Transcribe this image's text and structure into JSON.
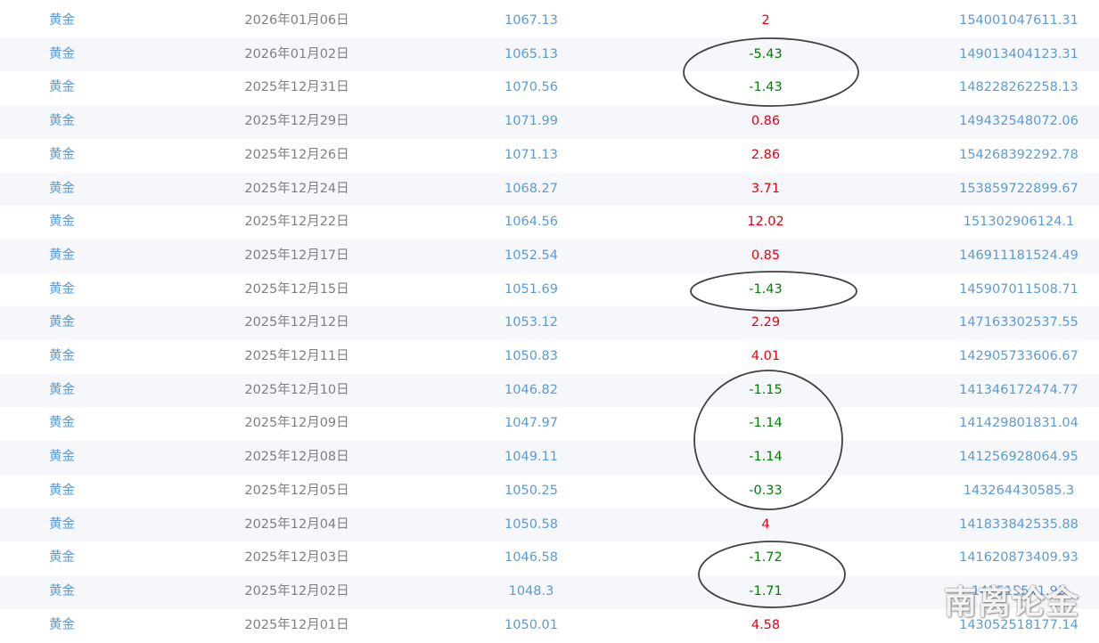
{
  "table": {
    "rows": [
      {
        "name": "黄金",
        "date": "2026年01月06日",
        "price": "1067.13",
        "change": "2",
        "direction": "up",
        "amount": "154001047611.31"
      },
      {
        "name": "黄金",
        "date": "2026年01月02日",
        "price": "1065.13",
        "change": "-5.43",
        "direction": "down",
        "amount": "149013404123.31"
      },
      {
        "name": "黄金",
        "date": "2025年12月31日",
        "price": "1070.56",
        "change": "-1.43",
        "direction": "down",
        "amount": "148228262258.13"
      },
      {
        "name": "黄金",
        "date": "2025年12月29日",
        "price": "1071.99",
        "change": "0.86",
        "direction": "up",
        "amount": "149432548072.06"
      },
      {
        "name": "黄金",
        "date": "2025年12月26日",
        "price": "1071.13",
        "change": "2.86",
        "direction": "up",
        "amount": "154268392292.78"
      },
      {
        "name": "黄金",
        "date": "2025年12月24日",
        "price": "1068.27",
        "change": "3.71",
        "direction": "up",
        "amount": "153859722899.67"
      },
      {
        "name": "黄金",
        "date": "2025年12月22日",
        "price": "1064.56",
        "change": "12.02",
        "direction": "up",
        "amount": "151302906124.1"
      },
      {
        "name": "黄金",
        "date": "2025年12月17日",
        "price": "1052.54",
        "change": "0.85",
        "direction": "up",
        "amount": "146911181524.49"
      },
      {
        "name": "黄金",
        "date": "2025年12月15日",
        "price": "1051.69",
        "change": "-1.43",
        "direction": "down",
        "amount": "145907011508.71"
      },
      {
        "name": "黄金",
        "date": "2025年12月12日",
        "price": "1053.12",
        "change": "2.29",
        "direction": "up",
        "amount": "147163302537.55"
      },
      {
        "name": "黄金",
        "date": "2025年12月11日",
        "price": "1050.83",
        "change": "4.01",
        "direction": "up",
        "amount": "142905733606.67"
      },
      {
        "name": "黄金",
        "date": "2025年12月10日",
        "price": "1046.82",
        "change": "-1.15",
        "direction": "down",
        "amount": "141346172474.77"
      },
      {
        "name": "黄金",
        "date": "2025年12月09日",
        "price": "1047.97",
        "change": "-1.14",
        "direction": "down",
        "amount": "141429801831.04"
      },
      {
        "name": "黄金",
        "date": "2025年12月08日",
        "price": "1049.11",
        "change": "-1.14",
        "direction": "down",
        "amount": "141256928064.95"
      },
      {
        "name": "黄金",
        "date": "2025年12月05日",
        "price": "1050.25",
        "change": "-0.33",
        "direction": "down",
        "amount": "143264430585.3"
      },
      {
        "name": "黄金",
        "date": "2025年12月04日",
        "price": "1050.58",
        "change": "4",
        "direction": "up",
        "amount": "141833842535.88"
      },
      {
        "name": "黄金",
        "date": "2025年12月03日",
        "price": "1046.58",
        "change": "-1.72",
        "direction": "down",
        "amount": "141620873409.93"
      },
      {
        "name": "黄金",
        "date": "2025年12月02日",
        "price": "1048.3",
        "change": "-1.71",
        "direction": "down",
        "amount": "141515541.93"
      },
      {
        "name": "黄金",
        "date": "2025年12月01日",
        "price": "1050.01",
        "change": "4.58",
        "direction": "up",
        "amount": "143052518177.14"
      }
    ]
  },
  "colors": {
    "up": "#e60012",
    "down": "#008000",
    "link": "#5b9bd5",
    "date": "#7f7f7f",
    "stripe": "#f6f7fb"
  },
  "watermark": "南离论金"
}
